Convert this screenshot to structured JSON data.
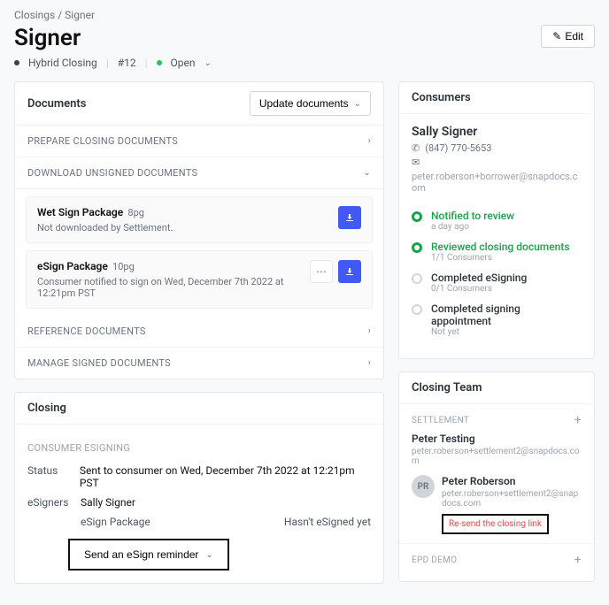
{
  "breadcrumb": {
    "root": "Closings",
    "current": "Signer"
  },
  "title": "Signer",
  "edit_label": "Edit",
  "meta": {
    "type": "Hybrid Closing",
    "number": "#12",
    "status": "Open"
  },
  "documents": {
    "heading": "Documents",
    "update_label": "Update documents",
    "prepare_label": "PREPARE CLOSING DOCUMENTS",
    "download_label": "DOWNLOAD UNSIGNED DOCUMENTS",
    "reference_label": "REFERENCE DOCUMENTS",
    "manage_label": "MANAGE SIGNED DOCUMENTS",
    "wet": {
      "title": "Wet Sign Package",
      "pages": "8pg",
      "desc": "Not downloaded by Settlement."
    },
    "esign": {
      "title": "eSign Package",
      "pages": "10pg",
      "desc": "Consumer notified to sign on Wed, December 7th 2022 at 12:21pm PST"
    }
  },
  "closing": {
    "heading": "Closing",
    "sub": "CONSUMER ESIGNING",
    "status_label": "Status",
    "status_val": "Sent to consumer on Wed, December 7th 2022 at 12:21pm PST",
    "esigners_label": "eSigners",
    "esigners_val": "Sally Signer",
    "pkg_name": "eSign Package",
    "pkg_status": "Hasn't eSigned yet",
    "reminder_label": "Send an eSign reminder"
  },
  "consumers": {
    "heading": "Consumers",
    "name": "Sally Signer",
    "phone": "(847) 770-5653",
    "email": "peter.roberson+borrower@snapdocs.com",
    "steps": {
      "notified": {
        "title": "Notified to review",
        "sub": "a day ago"
      },
      "reviewed": {
        "title": "Reviewed closing documents",
        "sub": "1/1 Consumers"
      },
      "esigning": {
        "title": "Completed eSigning",
        "sub": "0/1 Consumers"
      },
      "appt": {
        "title": "Completed signing appointment",
        "sub": "Not yet"
      }
    }
  },
  "team": {
    "heading": "Closing Team",
    "settlement_label": "SETTLEMENT",
    "settlement_name": "Peter Testing",
    "settlement_email": "peter.roberson+settlement2@snapdocs.com",
    "member_initials": "PR",
    "member_name": "Peter Roberson",
    "member_email": "peter.roberson+settlement2@snapdocs.com",
    "resend_label": "Re-send the closing link",
    "epd_label": "EPD DEMO"
  }
}
